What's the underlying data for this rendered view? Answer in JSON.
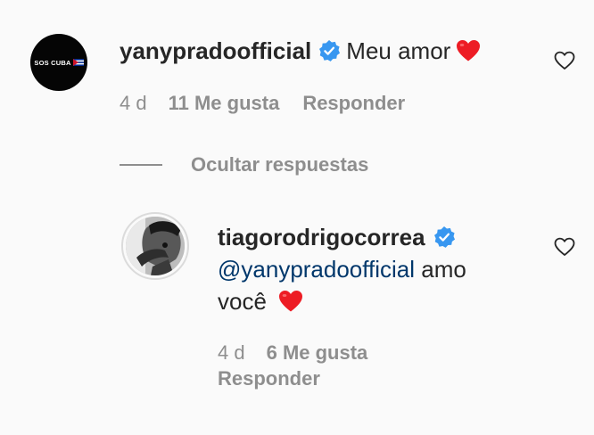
{
  "comment": {
    "avatar_label": "SOS CUBA",
    "username": "yanypradoofficial",
    "text": "Meu amor",
    "emoji": "red-heart",
    "age": "4 d",
    "likes": "11 Me gusta",
    "reply_label": "Responder"
  },
  "hide_replies_label": "Ocultar respuestas",
  "reply": {
    "username": "tiagorodrigocorrea",
    "mention": "@yanypradoofficial",
    "text": "amo você",
    "emoji": "red-heart",
    "age": "4 d",
    "likes": "6 Me gusta",
    "reply_label": "Responder"
  },
  "colors": {
    "background": "#fafafa",
    "text": "#262626",
    "secondary": "#8e8e8e",
    "verified_blue": "#3897f0",
    "mention": "#00376b",
    "heart": "#ed1c24"
  },
  "icons": {
    "verified": "verified-badge-icon",
    "like": "heart-outline-icon"
  }
}
